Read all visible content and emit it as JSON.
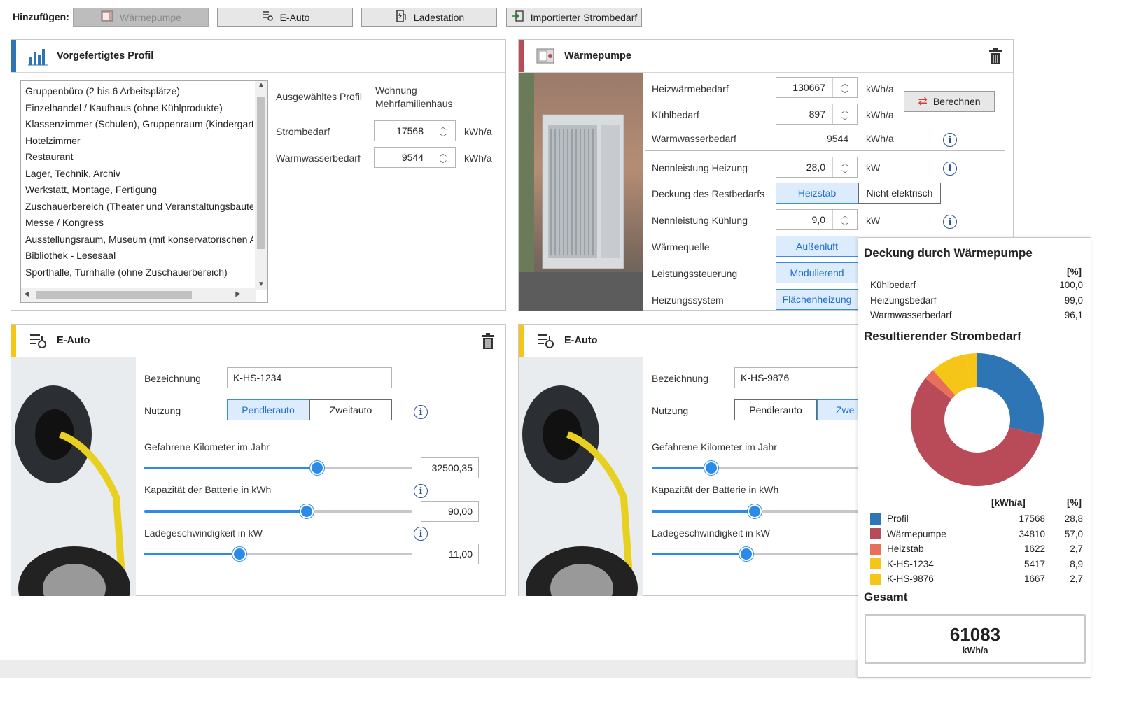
{
  "toolbar": {
    "label": "Hinzufügen:",
    "buttons": [
      "Wärmepumpe",
      "E-Auto",
      "Ladestation",
      "Importierter Strombedarf"
    ]
  },
  "profile_panel": {
    "title": "Vorgefertigtes Profil",
    "list_items": [
      "Gruppenbüro (2 bis 6 Arbeitsplätze)",
      "Einzelhandel / Kaufhaus (ohne Kühlprodukte)",
      "Klassenzimmer (Schulen), Gruppenraum (Kindergarte",
      "Hotelzimmer",
      "Restaurant",
      "Lager, Technik, Archiv",
      "Werkstatt, Montage, Fertigung",
      "Zuschauerbereich (Theater und Veranstaltungsbaute",
      "Messe / Kongress",
      "Ausstellungsraum, Museum (mit konservatorischen A",
      "Bibliothek - Lesesaal",
      "Sporthalle, Turnhalle (ohne Zuschauerbereich)"
    ],
    "selected_label": "Ausgewähltes Profil",
    "selected_value_line1": "Wohnung",
    "selected_value_line2": "Mehrfamilienhaus",
    "strom_label": "Strombedarf",
    "strom_value": "17568",
    "strom_unit": "kWh/a",
    "ww_label": "Warmwasserbedarf",
    "ww_value": "9544",
    "ww_unit": "kWh/a"
  },
  "heatpump_panel": {
    "title": "Wärmepumpe",
    "heiz_label": "Heizwärmebedarf",
    "heiz_value": "130667",
    "kuehl_label": "Kühlbedarf",
    "kuehl_value": "897",
    "ww_label": "Warmwasserbedarf",
    "ww_value": "9544",
    "unit_kwh": "kWh/a",
    "calc_button": "Berechnen",
    "nenn_heiz_label": "Nennleistung Heizung",
    "nenn_heiz_value": "28,0",
    "unit_kw": "kW",
    "deckung_label": "Deckung des Restbedarfs",
    "deckung_opt1": "Heizstab",
    "deckung_opt2": "Nicht elektrisch",
    "nenn_kuehl_label": "Nennleistung Kühlung",
    "nenn_kuehl_value": "9,0",
    "quelle_label": "Wärmequelle",
    "quelle_value": "Außenluft",
    "steuerung_label": "Leistungssteuerung",
    "steuerung_value": "Modulierend",
    "system_label": "Heizungssystem",
    "system_value": "Flächenheizung"
  },
  "eauto1": {
    "title": "E-Auto",
    "bez_label": "Bezeichnung",
    "bez_value": "K-HS-1234",
    "nutz_label": "Nutzung",
    "nutz_opt1": "Pendlerauto",
    "nutz_opt2": "Zweitauto",
    "km_label": "Gefahrene Kilometer im Jahr",
    "km_value": "32500,35",
    "km_fraction": 0.64,
    "bat_label": "Kapazität der Batterie in kWh",
    "bat_value": "90,00",
    "bat_fraction": 0.6,
    "lade_label": "Ladegeschwindigkeit in kW",
    "lade_value": "11,00",
    "lade_fraction": 0.35
  },
  "eauto2": {
    "title": "E-Auto",
    "bez_label": "Bezeichnung",
    "bez_value": "K-HS-9876",
    "nutz_label": "Nutzung",
    "nutz_opt1": "Pendlerauto",
    "nutz_opt2": "Zwe",
    "km_label": "Gefahrene Kilometer im Jahr",
    "km_fraction": 0.28,
    "bat_label": "Kapazität der Batterie in kWh",
    "bat_fraction": 0.49,
    "lade_label": "Ladegeschwindigkeit in kW",
    "lade_fraction": 0.45
  },
  "results": {
    "deckung_title": "Deckung durch Wärmepumpe",
    "pct_header": "[%]",
    "deckung_rows": [
      {
        "label": "Kühlbedarf",
        "value": "100,0"
      },
      {
        "label": "Heizungsbedarf",
        "value": "99,0"
      },
      {
        "label": "Warmwasserbedarf",
        "value": "96,1"
      }
    ],
    "strom_title": "Resultierender Strombedarf",
    "kwh_header": "[kWh/a]",
    "legend": [
      {
        "label": "Profil",
        "kwh": "17568",
        "pct": "28,8",
        "color": "#2e75b6"
      },
      {
        "label": "Wärmepumpe",
        "kwh": "34810",
        "pct": "57,0",
        "color": "#b94a57"
      },
      {
        "label": "Heizstab",
        "kwh": "1622",
        "pct": "2,7",
        "color": "#e8705a"
      },
      {
        "label": "K-HS-1234",
        "kwh": "5417",
        "pct": "8,9",
        "color": "#f5c518"
      },
      {
        "label": "K-HS-9876",
        "kwh": "1667",
        "pct": "2,7",
        "color": "#f5c518"
      }
    ],
    "gesamt_label": "Gesamt",
    "gesamt_value": "61083",
    "gesamt_unit": "kWh/a"
  },
  "colors": {
    "profile_accent": "#2e75b6",
    "heatpump_accent": "#b94a57",
    "eauto_accent": "#f5c518",
    "toggle_active": "#3c8de0",
    "slider": "#2b8be6"
  }
}
